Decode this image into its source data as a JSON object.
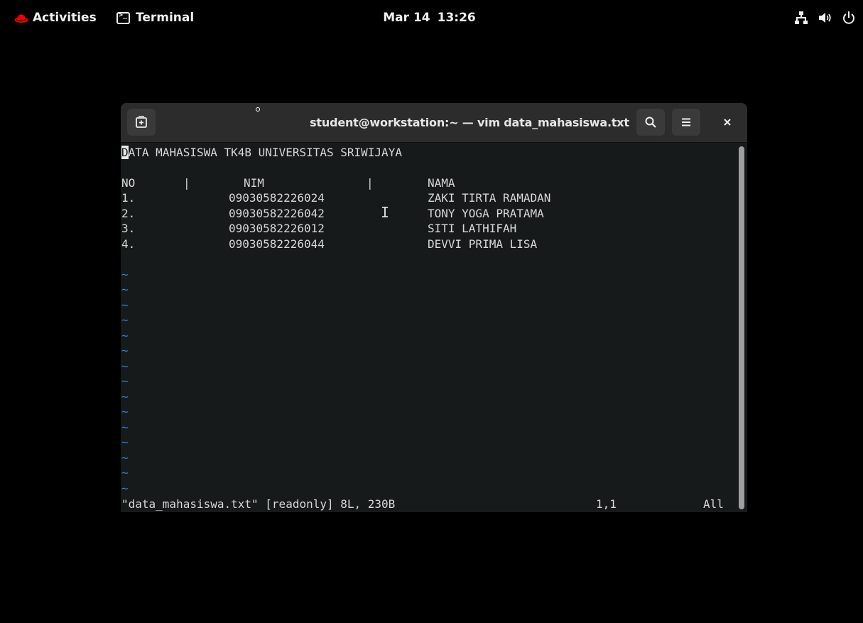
{
  "topbar": {
    "activities": "Activities",
    "app_name": "Terminal",
    "date": "Mar 14",
    "time": "13:26",
    "icons": [
      "network-icon",
      "volume-icon",
      "power-icon"
    ]
  },
  "window": {
    "title": "student@workstation:~ — vim data_mahasiswa.txt"
  },
  "vim": {
    "heading_first": "D",
    "heading_rest": "ATA MAHASISWA TK4B UNIVERSITAS SRIWIJAYA",
    "table_header": {
      "no": "NO",
      "sep1": "|",
      "nim": "NIM",
      "sep2": "|",
      "nama": "NAMA"
    },
    "rows": [
      {
        "no": "1.",
        "nim": "09030582226024",
        "nama": "ZAKI TIRTA RAMADAN"
      },
      {
        "no": "2.",
        "nim": "09030582226042",
        "nama": "TONY YOGA PRATAMA"
      },
      {
        "no": "3.",
        "nim": "09030582226012",
        "nama": "SITI LATHIFAH"
      },
      {
        "no": "4.",
        "nim": "09030582226044",
        "nama": "DEVVI PRIMA LISA"
      }
    ],
    "tilde": "~",
    "status_file": "\"data_mahasiswa.txt\" [readonly] 8L, 230B",
    "status_pos": "1,1",
    "status_scroll": "All"
  },
  "colors": {
    "background": "#000000",
    "terminal_bg": "#171a1a",
    "tilde": "#2a82d5",
    "redhat": "#ee0000"
  }
}
